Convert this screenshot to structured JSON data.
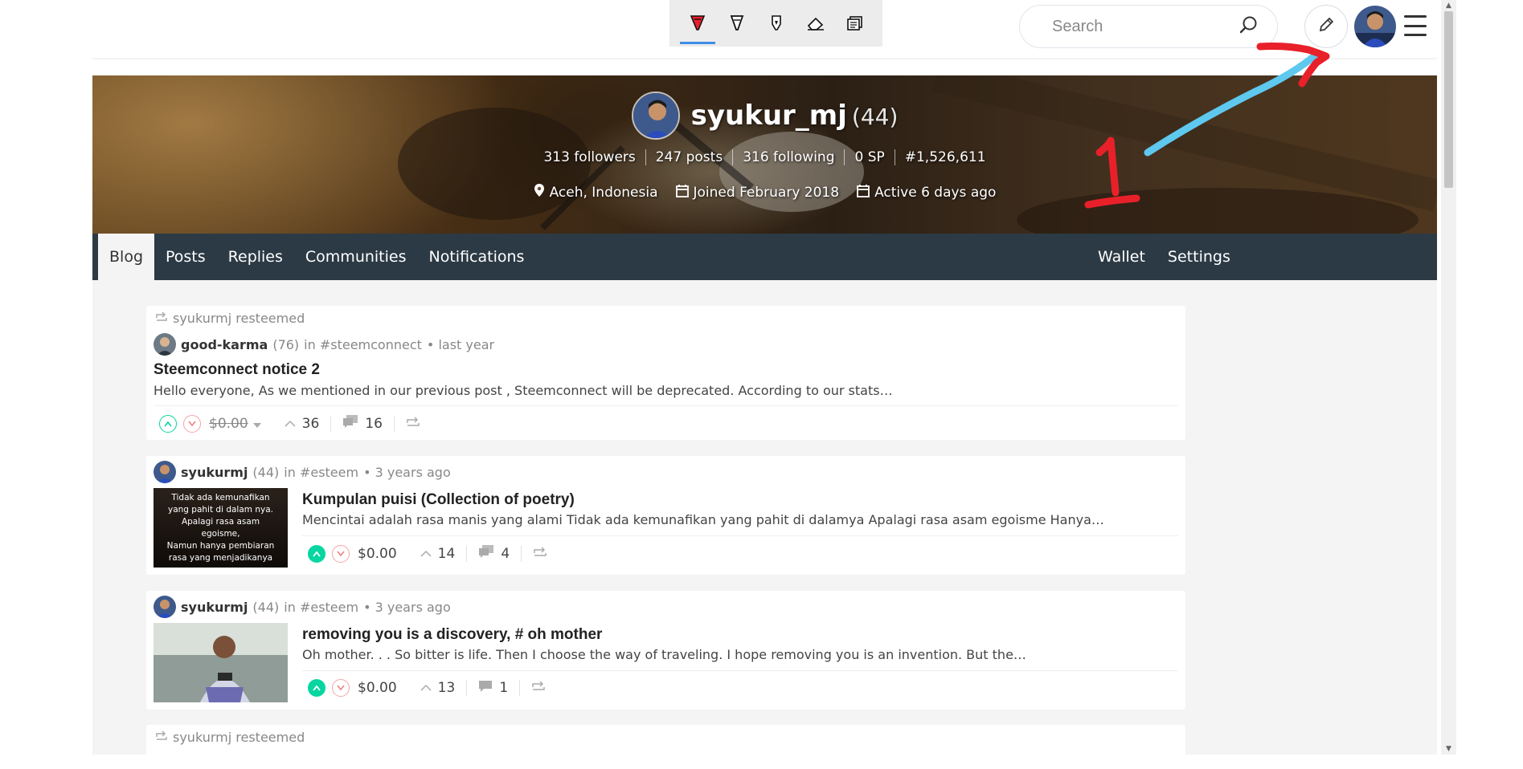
{
  "drawing_toolbar": {
    "tools": [
      "pen-red",
      "marker",
      "highlighter",
      "eraser",
      "copy"
    ]
  },
  "header": {
    "search_placeholder": "Search"
  },
  "profile": {
    "username": "syukur_mj",
    "reputation": "(44)",
    "followers": "313 followers",
    "posts": "247 posts",
    "following": "316 following",
    "sp": "0 SP",
    "rank": "#1,526,611",
    "location": "Aceh, Indonesia",
    "joined": "Joined February 2018",
    "active": "Active 6 days ago"
  },
  "tabs": {
    "left": [
      "Blog",
      "Posts",
      "Replies",
      "Communities",
      "Notifications"
    ],
    "right": [
      "Wallet",
      "Settings"
    ],
    "active": "Blog"
  },
  "feed": [
    {
      "resteemed_by": "syukurmj resteemed",
      "author": "good-karma",
      "author_rep": "(76)",
      "community": "in #steemconnect",
      "time": "• last year",
      "title": "Steemconnect notice 2",
      "body": "Hello everyone, As we mentioned in our previous post , Steemconnect will be deprecated. According to our stats…",
      "payout": "$0.00",
      "votes": "36",
      "comments": "16"
    },
    {
      "author": "syukurmj",
      "author_rep": "(44)",
      "community": "in #esteem",
      "time": "• 3 years ago",
      "title": "Kumpulan puisi (Collection of poetry)",
      "body": "Mencintai adalah rasa manis yang alami Tidak ada kemunafikan yang pahit di dalamya Apalagi rasa asam egoisme Hanya…",
      "thumb_text": [
        "Tidak ada kemunafikan",
        "yang pahit di dalam nya.",
        "Apalagi rasa asam",
        "egoisme,",
        "Namun hanya pembiaran",
        "rasa yang menjadikanya"
      ],
      "payout": "$0.00",
      "votes": "14",
      "comments": "4"
    },
    {
      "author": "syukurmj",
      "author_rep": "(44)",
      "community": "in #esteem",
      "time": "• 3 years ago",
      "title": "removing you is a discovery, # oh mother",
      "body": "Oh mother. . . So bitter is life. Then I choose the way of traveling. I hope removing you is an invention. But the…",
      "payout": "$0.00",
      "votes": "13",
      "comments": "1"
    },
    {
      "resteemed_by": "syukurmj resteemed"
    }
  ],
  "annotation": {
    "label": "1",
    "colors": {
      "arrow_line": "#5ec8ef",
      "arrow_head": "#e8202a",
      "number": "#e8202a"
    }
  },
  "colors": {
    "accent": "#07d6a0",
    "tabbar": "#2c3a45",
    "downvote": "#f5a5a5"
  }
}
